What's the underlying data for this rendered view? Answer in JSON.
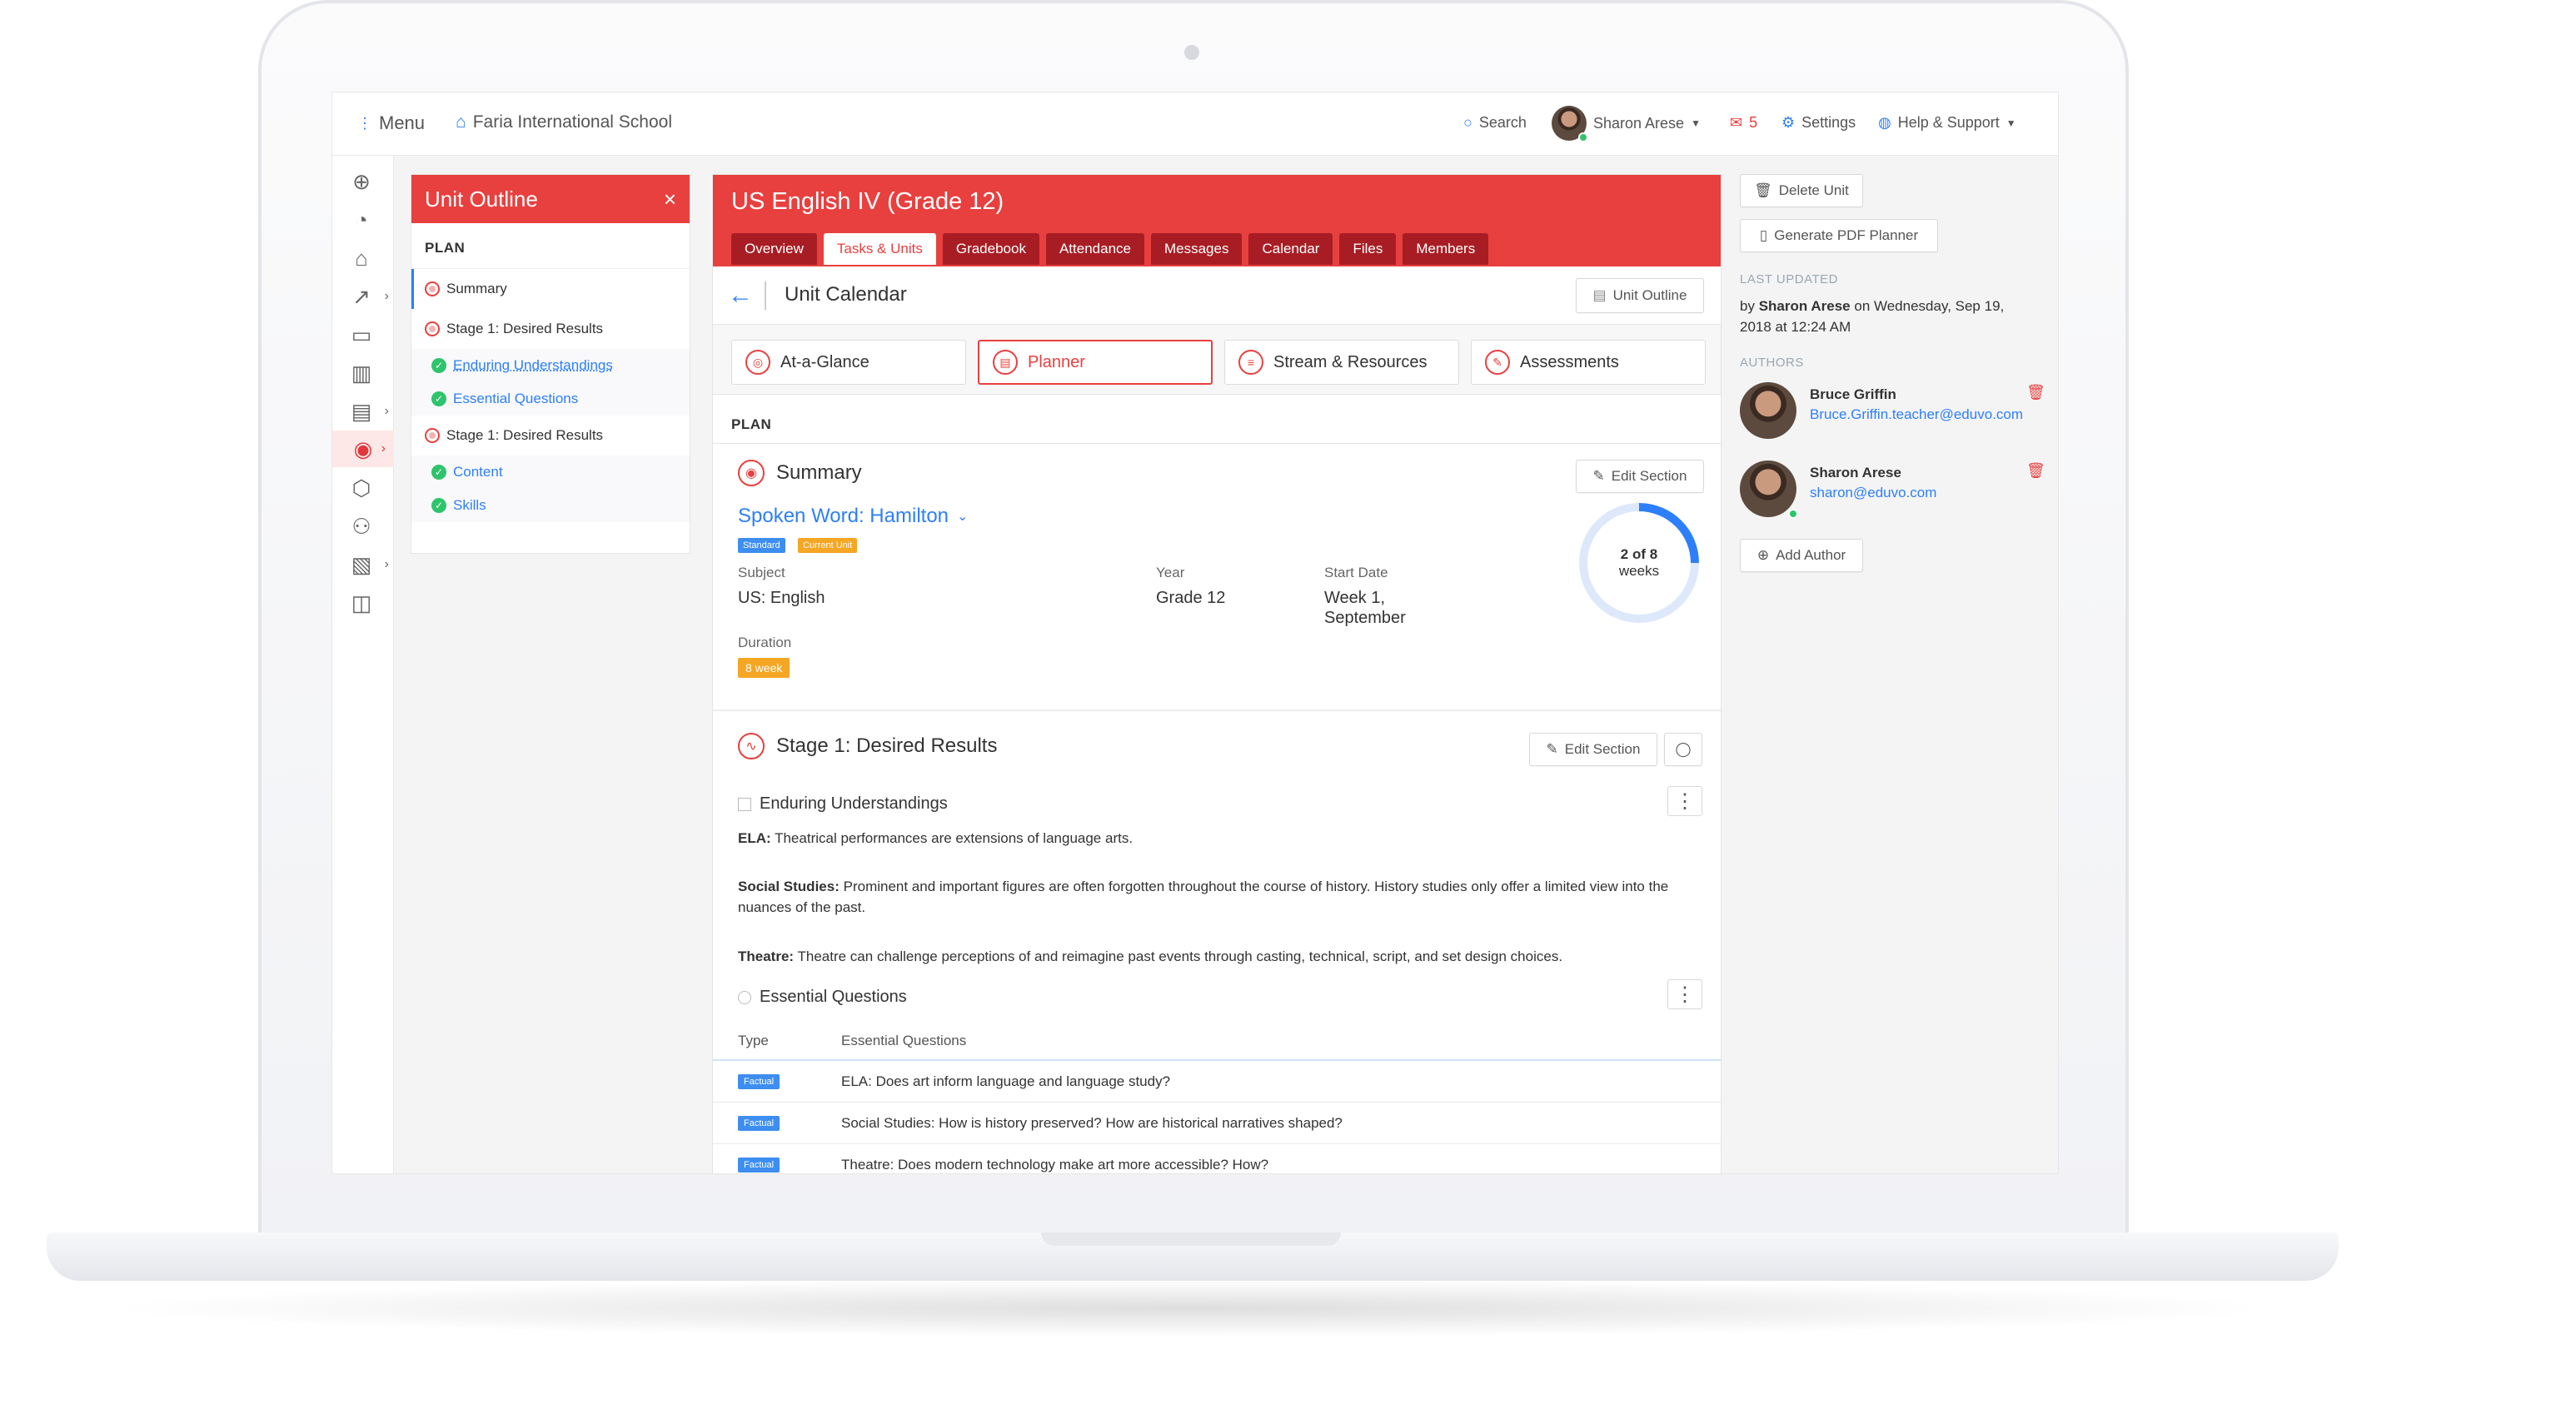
{
  "topbar": {
    "menu": "Menu",
    "school": "Faria International School",
    "search": "Search",
    "user": "Sharon Arese",
    "mail_count": "5",
    "settings": "Settings",
    "help": "Help & Support"
  },
  "outline": {
    "title": "Unit Outline",
    "plan": "PLAN",
    "items": [
      {
        "label": "Summary"
      },
      {
        "label": "Stage 1: Desired Results"
      },
      {
        "label": "Enduring Understandings"
      },
      {
        "label": "Essential Questions"
      },
      {
        "label": "Stage 1: Desired Results"
      },
      {
        "label": "Content"
      },
      {
        "label": "Skills"
      }
    ]
  },
  "course": {
    "title": "US English IV (Grade 12)",
    "tabs": [
      "Overview",
      "Tasks & Units",
      "Gradebook",
      "Attendance",
      "Messages",
      "Calendar",
      "Files",
      "Members"
    ]
  },
  "calendar": {
    "title": "Unit Calendar",
    "outline_btn": "Unit Outline"
  },
  "views": [
    "At-a-Glance",
    "Planner",
    "Stream & Resources",
    "Assessments"
  ],
  "plan_label": "PLAN",
  "summary": {
    "title": "Summary",
    "edit": "Edit Section",
    "unit_name": "Spoken Word: Hamilton",
    "badge_standard": "Standard",
    "badge_current": "Current Unit",
    "subject_label": "Subject",
    "subject": "US: English",
    "year_label": "Year",
    "year": "Grade 12",
    "start_label": "Start Date",
    "start_line1": "Week 1,",
    "start_line2": "September",
    "duration_label": "Duration",
    "duration": "8 week",
    "progress_line1": "2 of 8",
    "progress_line2": "weeks",
    "progress_fraction": 0.25
  },
  "stage1": {
    "title": "Stage 1: Desired Results",
    "edit": "Edit Section",
    "eu_title": "Enduring Understandings",
    "eu": [
      {
        "subject": "ELA:",
        "text": "Theatrical performances are extensions of language arts."
      },
      {
        "subject": "Social Studies:",
        "text": "Prominent and important figures are often forgotten throughout the course of history. History studies only offer a limited view into the nuances of the past."
      },
      {
        "subject": "Theatre:",
        "text": "Theatre can challenge perceptions of and reimagine past events through casting, technical, script, and set design choices."
      }
    ],
    "eq_title": "Essential Questions",
    "eq_headers": {
      "type": "Type",
      "question": "Essential Questions"
    },
    "eq_rows": [
      {
        "type": "Factual",
        "question": "ELA: Does art inform language and language study?"
      },
      {
        "type": "Factual",
        "question": "Social Studies: How is history preserved? How are historical narratives shaped?"
      },
      {
        "type": "Factual",
        "question": "Theatre: Does modern technology make art more accessible? How?"
      }
    ]
  },
  "sidebar_right": {
    "delete": "Delete Unit",
    "pdf": "Generate PDF Planner",
    "last_updated_label": "LAST UPDATED",
    "by_prefix": "by",
    "updated_by": "Sharon Arese",
    "updated_on": "on Wednesday, Sep 19,",
    "updated_time": "2018 at 12:24 AM",
    "authors_label": "AUTHORS",
    "authors": [
      {
        "name": "Bruce Griffin",
        "email": "Bruce.Griffin.teacher@eduvo.com"
      },
      {
        "name": "Sharon Arese",
        "email": "sharon@eduvo.com"
      }
    ],
    "add_author": "Add Author"
  },
  "colors": {
    "brand_red": "#e8403f",
    "tab_dark": "#a81d24",
    "accent_blue": "#2d7ff9",
    "success": "#2ec46b",
    "warning": "#f5a623"
  }
}
